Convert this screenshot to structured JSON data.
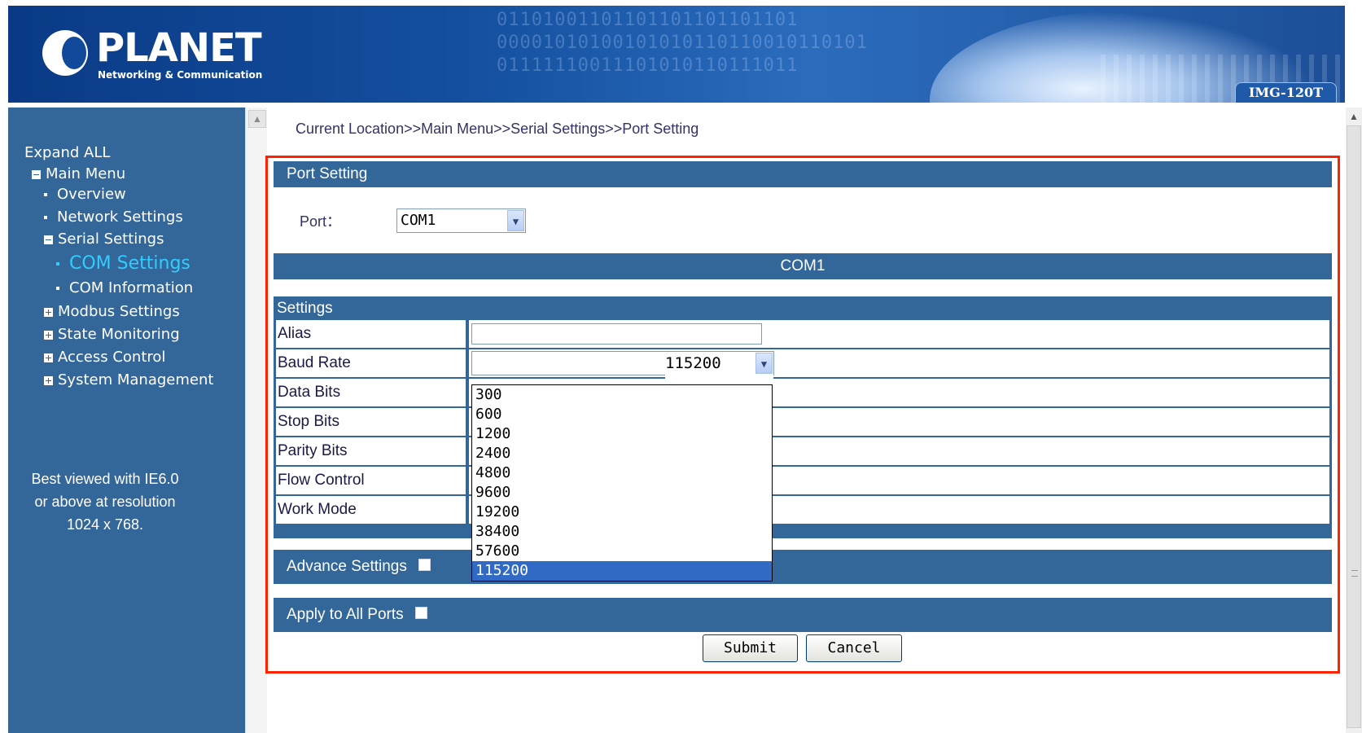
{
  "header": {
    "brand": "PLANET",
    "tagline": "Networking & Communication",
    "model": "IMG-120T",
    "decor_bits": "01101001101101101101101101\n00001010100101010110110010110101\n01111110011101010110111011"
  },
  "sidebar": {
    "expand_all": "Expand ALL",
    "main_menu": "Main Menu",
    "items": [
      {
        "label": "Overview"
      },
      {
        "label": "Network Settings"
      },
      {
        "label": "Serial Settings"
      },
      {
        "label": "COM Settings"
      },
      {
        "label": "COM Information"
      },
      {
        "label": "Modbus Settings"
      },
      {
        "label": "State Monitoring"
      },
      {
        "label": "Access Control"
      },
      {
        "label": "System Management"
      }
    ],
    "note": [
      "Best viewed with IE6.0",
      "or above at resolution",
      "1024 x 768."
    ]
  },
  "breadcrumb": "Current Location>>Main Menu>>Serial Settings>>Port Setting",
  "port_setting": {
    "title": "Port Setting",
    "port_label": "Port：",
    "port_value": "COM1",
    "com_header": "COM1"
  },
  "settings": {
    "title": "Settings",
    "rows": [
      {
        "label": "Alias",
        "value": ""
      },
      {
        "label": "Baud Rate",
        "value": "115200"
      },
      {
        "label": "Data Bits"
      },
      {
        "label": "Stop Bits"
      },
      {
        "label": "Parity Bits"
      },
      {
        "label": "Flow Control"
      },
      {
        "label": "Work Mode"
      }
    ],
    "baud_options": [
      "300",
      "600",
      "1200",
      "2400",
      "4800",
      "9600",
      "19200",
      "38400",
      "57600",
      "115200"
    ],
    "baud_selected": "115200"
  },
  "advance_settings": {
    "label": "Advance Settings",
    "checked": false
  },
  "apply_all": {
    "label": "Apply to All Ports",
    "checked": false
  },
  "buttons": {
    "submit": "Submit",
    "cancel": "Cancel"
  },
  "colors": {
    "nav_bg": "#336699",
    "active_item": "#33ccff",
    "highlight_border": "#ff2200",
    "selected_option": "#316ac5"
  }
}
